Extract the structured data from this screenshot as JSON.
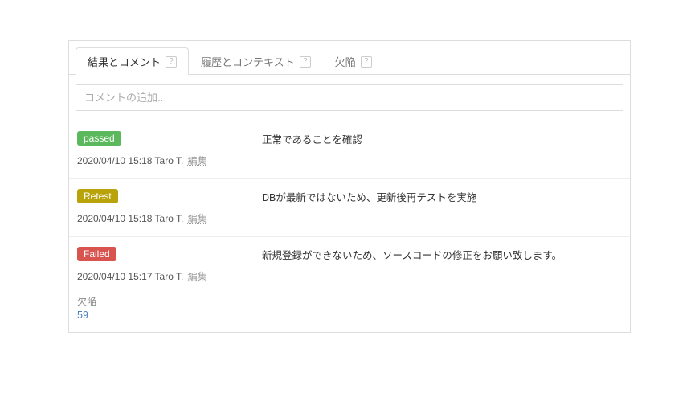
{
  "tabs": [
    {
      "label": "結果とコメント",
      "active": true
    },
    {
      "label": "履歴とコンテキスト",
      "active": false
    },
    {
      "label": "欠陥",
      "active": false
    }
  ],
  "commentInput": {
    "placeholder": "コメントの追加.."
  },
  "entries": [
    {
      "status": "passed",
      "badgeClass": "badge-passed",
      "timestamp": "2020/04/10 15:18",
      "author": "Taro T.",
      "editLabel": "編集",
      "comment": "正常であることを確認"
    },
    {
      "status": "Retest",
      "badgeClass": "badge-retest",
      "timestamp": "2020/04/10 15:18",
      "author": "Taro T.",
      "editLabel": "編集",
      "comment": "DBが最新ではないため、更新後再テストを実施"
    },
    {
      "status": "Failed",
      "badgeClass": "badge-failed",
      "timestamp": "2020/04/10 15:17",
      "author": "Taro T.",
      "editLabel": "編集",
      "comment": "新規登録ができないため、ソースコードの修正をお願い致します。",
      "defectLabel": "欠陥",
      "defectId": "59"
    }
  ]
}
